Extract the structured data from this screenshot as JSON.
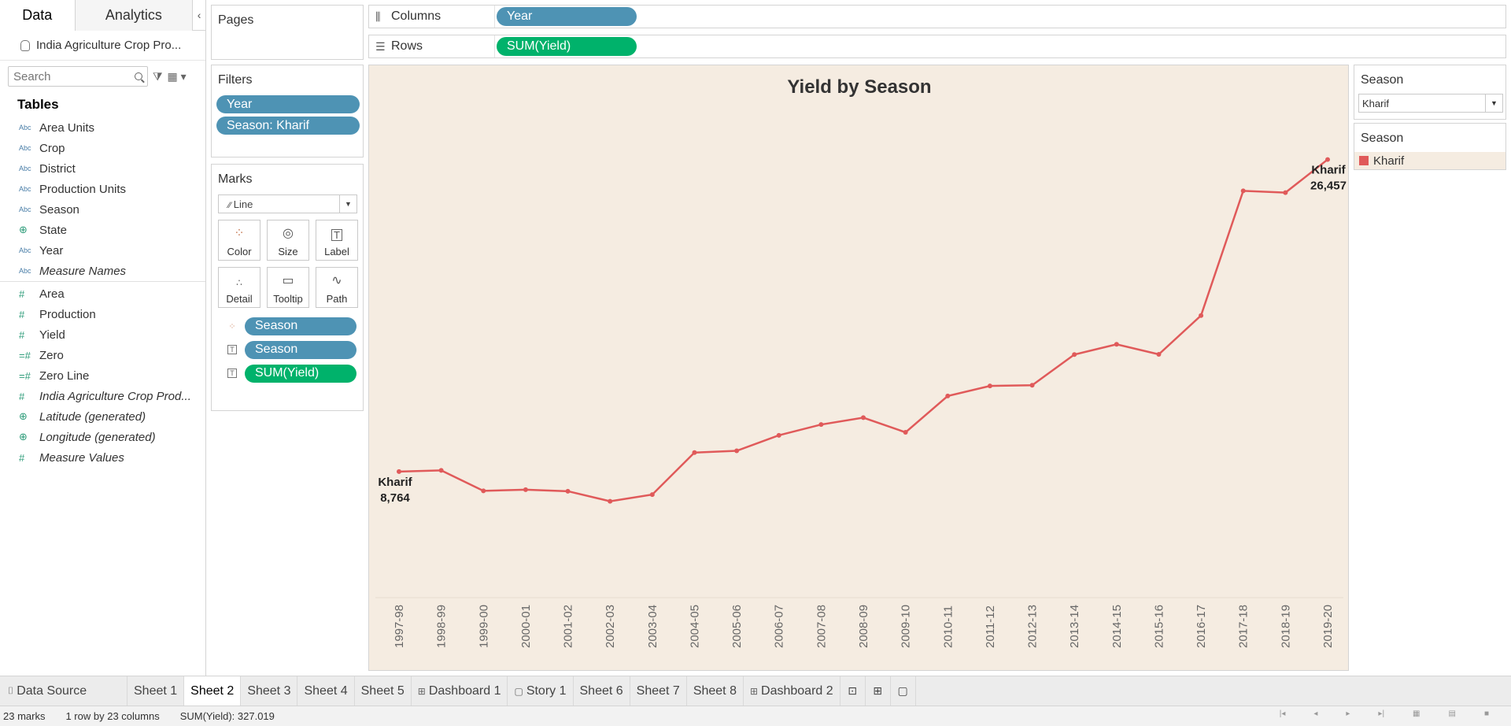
{
  "datapane": {
    "tab_data": "Data",
    "tab_analytics": "Analytics",
    "datasource": "India Agriculture Crop Pro...",
    "search_placeholder": "Search",
    "tables_header": "Tables",
    "dimensions": [
      {
        "type": "Abc",
        "name": "Area Units"
      },
      {
        "type": "Abc",
        "name": "Crop"
      },
      {
        "type": "Abc",
        "name": "District"
      },
      {
        "type": "Abc",
        "name": "Production Units"
      },
      {
        "type": "Abc",
        "name": "Season"
      },
      {
        "type": "⊕",
        "name": "State"
      },
      {
        "type": "Abc",
        "name": "Year"
      },
      {
        "type": "Abc",
        "name": "Measure Names"
      }
    ],
    "measures": [
      {
        "type": "#",
        "name": "Area"
      },
      {
        "type": "#",
        "name": "Production"
      },
      {
        "type": "#",
        "name": "Yield"
      },
      {
        "type": "=#",
        "name": "Zero"
      },
      {
        "type": "=#",
        "name": "Zero Line"
      },
      {
        "type": "#",
        "name": "India Agriculture Crop Prod..."
      },
      {
        "type": "⊕",
        "name": "Latitude (generated)"
      },
      {
        "type": "⊕",
        "name": "Longitude (generated)"
      },
      {
        "type": "#",
        "name": "Measure Values"
      }
    ]
  },
  "shelves": {
    "pages_title": "Pages",
    "columns_label": "Columns",
    "columns_pill": "Year",
    "rows_label": "Rows",
    "rows_pill": "SUM(Yield)",
    "filters_title": "Filters",
    "filter_pills": [
      "Year",
      "Season: Kharif"
    ]
  },
  "marks": {
    "title": "Marks",
    "mark_type": "Line",
    "buttons": [
      "Color",
      "Size",
      "Label",
      "Detail",
      "Tooltip",
      "Path"
    ],
    "fields": [
      {
        "icon": "color",
        "label": "Season",
        "color": "blue"
      },
      {
        "icon": "text",
        "label": "Season",
        "color": "blue"
      },
      {
        "icon": "text",
        "label": "SUM(Yield)",
        "color": "green"
      }
    ]
  },
  "right": {
    "filter_title": "Season",
    "filter_value": "Kharif",
    "legend_title": "Season",
    "legend_item": "Kharif",
    "legend_color": "#e05a5a"
  },
  "chart_data": {
    "type": "line",
    "title": "Yield by Season",
    "categories": [
      "1997-98",
      "1998-99",
      "1999-00",
      "2000-01",
      "2001-02",
      "2002-03",
      "2003-04",
      "2004-05",
      "2005-06",
      "2006-07",
      "2007-08",
      "2008-09",
      "2009-10",
      "2010-11",
      "2011-12",
      "2012-13",
      "2013-14",
      "2014-15",
      "2015-16",
      "2016-17",
      "2017-18",
      "2018-19",
      "2019-20"
    ],
    "series": [
      {
        "name": "Kharif",
        "color": "#e05a5a",
        "values": [
          8764,
          8830,
          7670,
          7740,
          7650,
          7080,
          7460,
          9840,
          9940,
          10820,
          11430,
          11820,
          10990,
          13050,
          13620,
          13660,
          15400,
          15980,
          15410,
          17610,
          24680,
          24580,
          26457
        ]
      }
    ],
    "first_label": {
      "name": "Kharif",
      "value": "8,764"
    },
    "last_label": {
      "name": "Kharif",
      "value": "26,457"
    },
    "background": "#f5ece1"
  },
  "sheet_tabs": [
    {
      "label": "Data Source",
      "icon": "datasource",
      "active": false
    },
    {
      "label": "Sheet 1",
      "active": false
    },
    {
      "label": "Sheet 2",
      "active": true
    },
    {
      "label": "Sheet 3",
      "active": false
    },
    {
      "label": "Sheet 4",
      "active": false
    },
    {
      "label": "Sheet 5",
      "active": false
    },
    {
      "label": "Dashboard 1",
      "icon": "dashboard",
      "active": false
    },
    {
      "label": "Story 1",
      "icon": "story",
      "active": false
    },
    {
      "label": "Sheet 6",
      "active": false
    },
    {
      "label": "Sheet 7",
      "active": false
    },
    {
      "label": "Sheet 8",
      "active": false
    },
    {
      "label": "Dashboard 2",
      "icon": "dashboard",
      "active": false
    }
  ],
  "status": {
    "marks": "23 marks",
    "dims": "1 row by 23 columns",
    "sum": "SUM(Yield): 327.019"
  }
}
